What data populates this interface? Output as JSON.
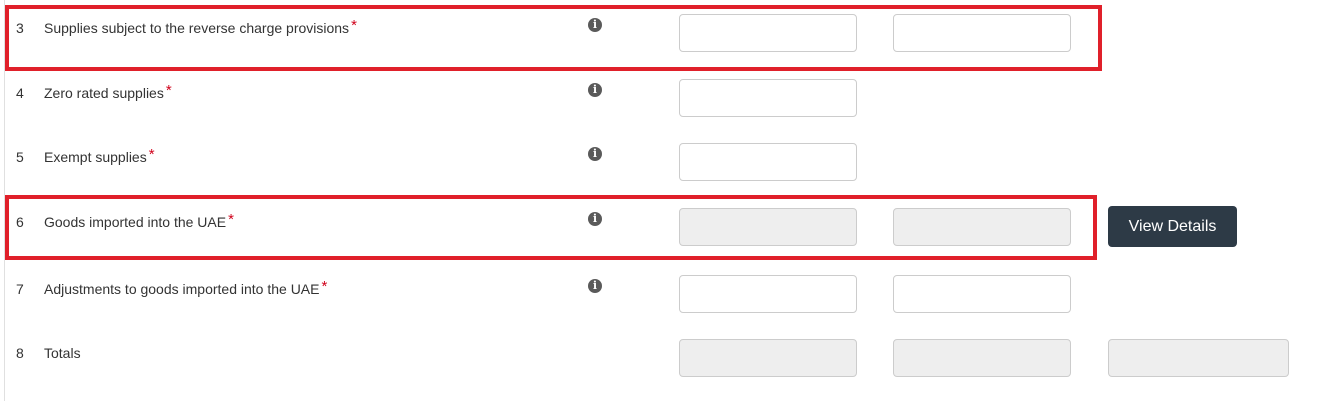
{
  "rows": [
    {
      "num": "3",
      "label": "Supplies subject to the reverse charge provisions",
      "required": "*",
      "info_icon": "info-circle-icon",
      "field1_value": "",
      "field2_value": ""
    },
    {
      "num": "4",
      "label": "Zero rated supplies",
      "required": "*",
      "info_icon": "info-circle-icon",
      "field1_value": ""
    },
    {
      "num": "5",
      "label": "Exempt supplies",
      "required": "*",
      "info_icon": "info-circle-icon",
      "field1_value": ""
    },
    {
      "num": "6",
      "label": "Goods imported into the UAE",
      "required": "*",
      "info_icon": "info-circle-icon",
      "field1_value": "",
      "field2_value": "",
      "button_label": "View Details"
    },
    {
      "num": "7",
      "label": "Adjustments to goods imported into the UAE",
      "required": "*",
      "info_icon": "info-circle-icon",
      "field1_value": "",
      "field2_value": ""
    },
    {
      "num": "8",
      "label": "Totals",
      "field1_value": "",
      "field2_value": "",
      "field3_value": ""
    }
  ],
  "colors": {
    "highlight": "#e0202a",
    "required": "#d0021b",
    "button_bg": "#2d3a46",
    "disabled_field_bg": "#eeeeee"
  }
}
